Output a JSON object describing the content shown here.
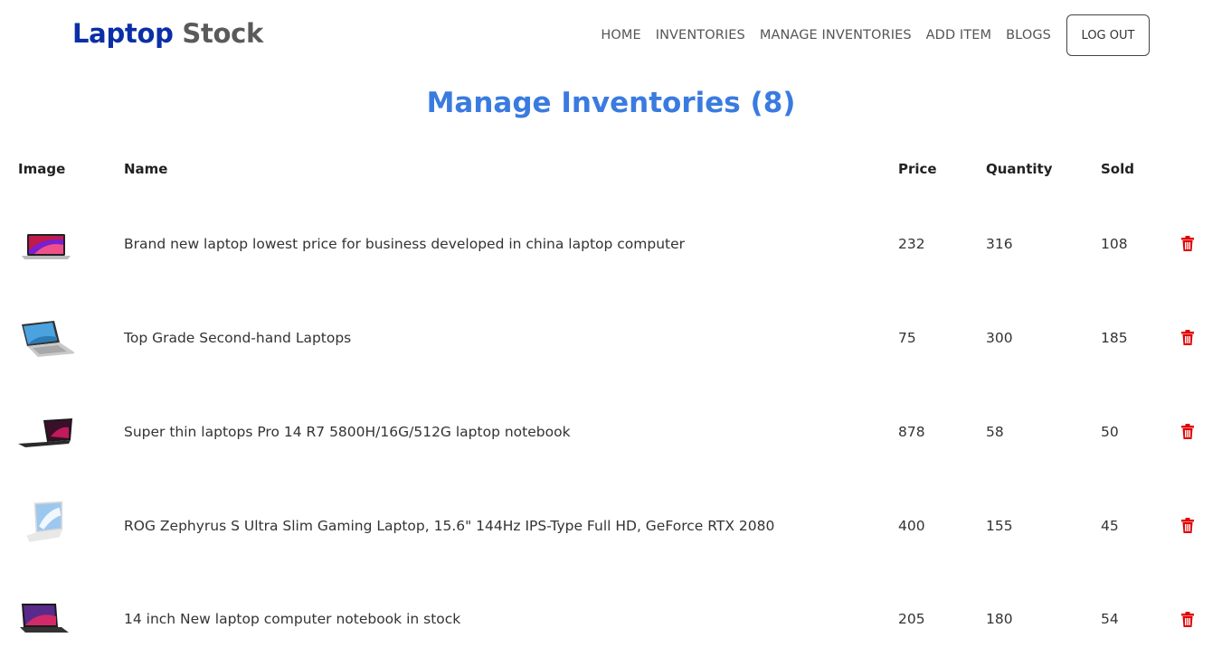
{
  "brand": {
    "part1": "Laptop",
    "part2": "Stock"
  },
  "nav": {
    "items": [
      "HOME",
      "INVENTORIES",
      "MANAGE INVENTORIES",
      "ADD ITEM",
      "BLOGS"
    ],
    "logout_label": "LOG OUT"
  },
  "page": {
    "title": "Manage Inventories (8)"
  },
  "table": {
    "headers": {
      "image": "Image",
      "name": "Name",
      "price": "Price",
      "quantity": "Quantity",
      "sold": "Sold"
    },
    "rows": [
      {
        "name": "Brand new laptop lowest price for business developed in china laptop computer",
        "price": "232",
        "quantity": "316",
        "sold": "108"
      },
      {
        "name": "Top Grade Second-hand Laptops",
        "price": "75",
        "quantity": "300",
        "sold": "185"
      },
      {
        "name": "Super thin laptops Pro 14 R7 5800H/16G/512G laptop notebook",
        "price": "878",
        "quantity": "58",
        "sold": "50"
      },
      {
        "name": "ROG Zephyrus S Ultra Slim Gaming Laptop, 15.6\" 144Hz IPS-Type Full HD, GeForce RTX 2080",
        "price": "400",
        "quantity": "155",
        "sold": "45"
      },
      {
        "name": "14 inch New laptop computer notebook in stock",
        "price": "205",
        "quantity": "180",
        "sold": "54"
      }
    ]
  },
  "colors": {
    "brand_blue": "#0a2fa6",
    "title_blue": "#3a7be0",
    "delete_red": "#e00000"
  },
  "icons": {
    "delete": "trash-icon",
    "product": "laptop-thumbnail"
  }
}
